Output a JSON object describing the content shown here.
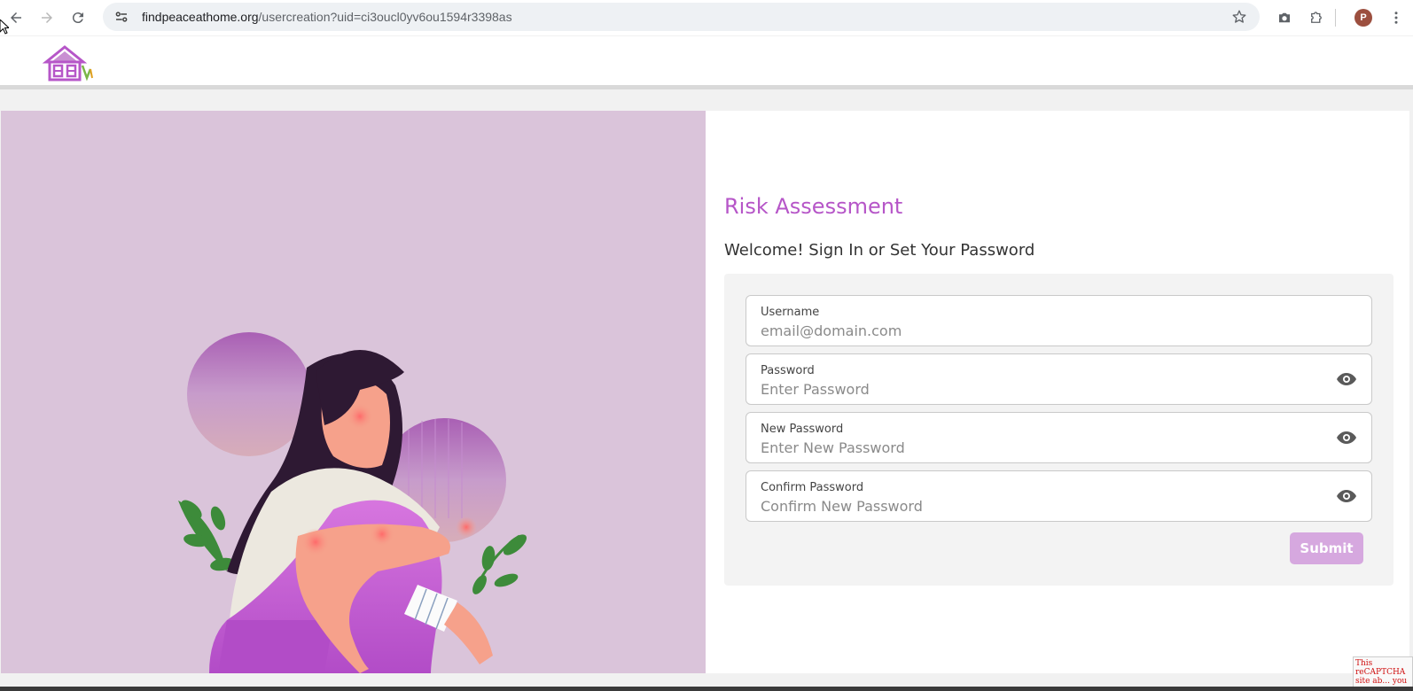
{
  "browser": {
    "url_domain": "findpeaceathome.org",
    "url_path": "/usercreation?uid=ci3oucl0yv6ou1594r3398as",
    "profile_initial": "P"
  },
  "icons": {
    "back": "back-arrow-icon",
    "forward": "forward-arrow-icon",
    "reload": "reload-icon",
    "site_info": "site-settings-icon",
    "star": "star-icon",
    "camera": "camera-icon",
    "extensions": "puzzle-icon",
    "menu": "more-vert-icon",
    "eye": "eye-icon"
  },
  "colors": {
    "accent": "#b656c8",
    "left_panel": "#dac4da",
    "submit_disabled": "#d6a8df"
  },
  "page": {
    "title": "Risk Assessment",
    "subtitle": "Welcome! Sign In or Set Your Password"
  },
  "form": {
    "username": {
      "label": "Username",
      "placeholder": "email@domain.com"
    },
    "password": {
      "label": "Password",
      "placeholder": "Enter Password"
    },
    "new_password": {
      "label": "New Password",
      "placeholder": "Enter New Password"
    },
    "confirm_password": {
      "label": "Confirm Password",
      "placeholder": "Confirm New Password"
    },
    "submit_label": "Submit"
  },
  "recaptcha": {
    "text": "This reCAPTCHA site ab... you a"
  }
}
